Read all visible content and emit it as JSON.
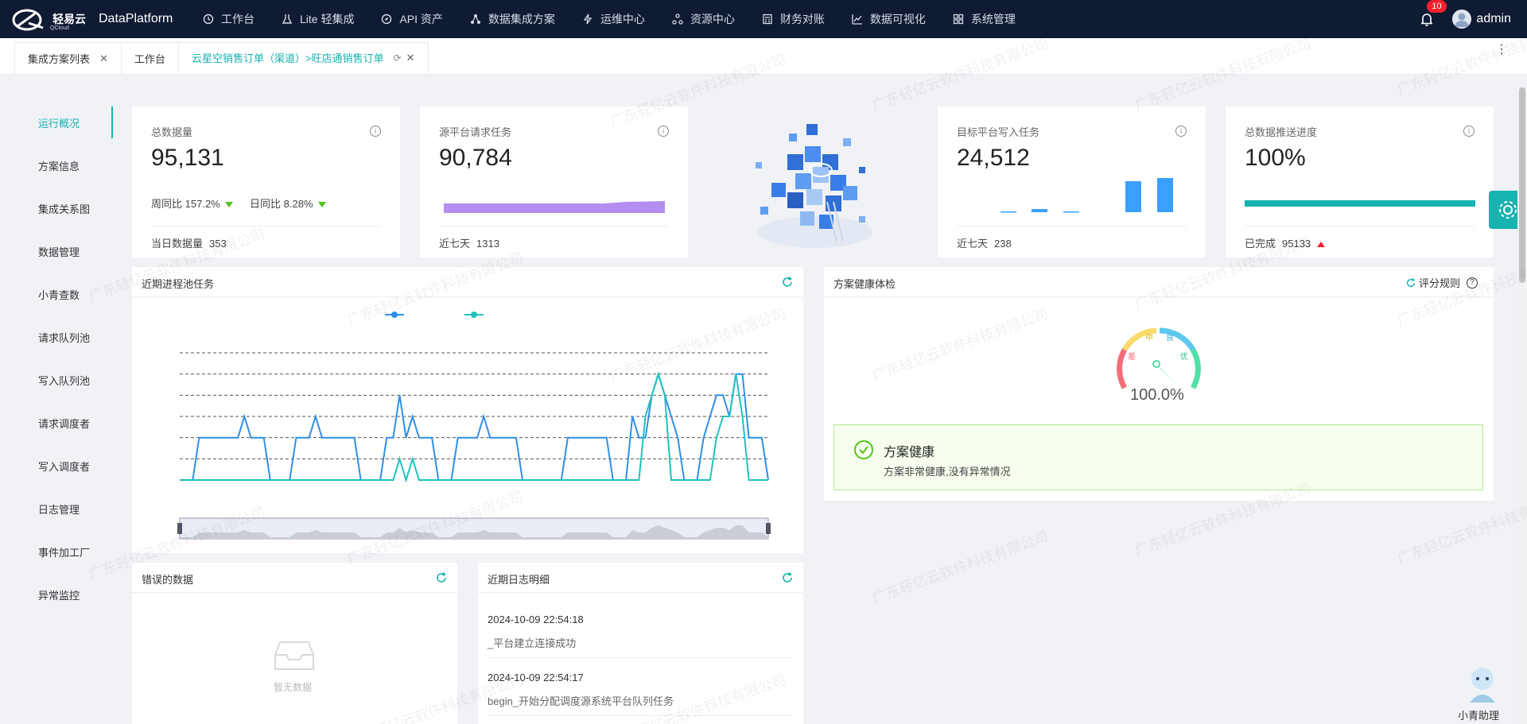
{
  "app": {
    "logo_text": "轻易云",
    "logo_sub": "QCloud",
    "product": "DataPlatform"
  },
  "nav": {
    "items": [
      {
        "label": "工作台",
        "icon": "clock-icon"
      },
      {
        "label": "Lite 轻集成",
        "icon": "flask-icon"
      },
      {
        "label": "API 资产",
        "icon": "compass-icon"
      },
      {
        "label": "数据集成方案",
        "icon": "network-icon"
      },
      {
        "label": "运维中心",
        "icon": "bolt-icon"
      },
      {
        "label": "资源中心",
        "icon": "nodes-icon"
      },
      {
        "label": "财务对账",
        "icon": "calculator-icon"
      },
      {
        "label": "数据可视化",
        "icon": "chart-icon"
      },
      {
        "label": "系统管理",
        "icon": "grid-icon"
      }
    ],
    "notification_count": "10",
    "user": "admin"
  },
  "tabs": [
    {
      "label": "集成方案列表",
      "closable": true
    },
    {
      "label": "工作台",
      "closable": false
    },
    {
      "label": "云星空销售订单（渠道）>旺店通销售订单",
      "closable": true,
      "active": true
    }
  ],
  "sidebar": {
    "items": [
      {
        "label": "运行概况",
        "active": true
      },
      {
        "label": "方案信息"
      },
      {
        "label": "集成关系图"
      },
      {
        "label": "数据管理"
      },
      {
        "label": "小青查数"
      },
      {
        "label": "请求队列池"
      },
      {
        "label": "写入队列池"
      },
      {
        "label": "请求调度者"
      },
      {
        "label": "写入调度者"
      },
      {
        "label": "日志管理"
      },
      {
        "label": "事件加工厂"
      },
      {
        "label": "异常监控"
      }
    ]
  },
  "stats": {
    "total": {
      "title": "总数据量",
      "value": "95,131",
      "wow_label": "周同比",
      "wow": "157.2%",
      "dod_label": "日同比",
      "dod": "8.28%",
      "foot_label": "当日数据量",
      "foot_value": "353"
    },
    "source": {
      "title": "源平台请求任务",
      "value": "90,784",
      "foot_label": "近七天",
      "foot_value": "1313"
    },
    "target": {
      "title": "目标平台写入任务",
      "value": "24,512",
      "foot_label": "近七天",
      "foot_value": "238"
    },
    "progress": {
      "title": "总数据推送进度",
      "value": "100%",
      "progress": 1.0,
      "foot_label": "已完成",
      "foot_value": "95133"
    }
  },
  "panels": {
    "pool": {
      "title": "近期进程池任务"
    },
    "health": {
      "title": "方案健康体检",
      "rule_label": "评分规则",
      "gauge_value": "100.0%",
      "gauge_labels": {
        "bad": "差",
        "mid": "中",
        "good": "良",
        "excellent": "优"
      },
      "status_title": "方案健康",
      "status_desc": "方案非常健康,没有异常情况"
    },
    "errors": {
      "title": "错误的数据",
      "empty": "暂无数据"
    },
    "logs": {
      "title": "近期日志明细",
      "entries": [
        {
          "time": "2024-10-09 22:54:18",
          "message": "_平台建立连接成功"
        },
        {
          "time": "2024-10-09 22:54:17",
          "message": "begin_开始分配调度源系统平台队列任务"
        }
      ]
    }
  },
  "assistant": {
    "label": "小青助理"
  },
  "watermark": "广东轻亿云软件科技有限公司",
  "colors": {
    "accent": "#16b3b0",
    "nav_bg": "#0f1b33",
    "series_a": "#2f8fe6",
    "series_b": "#1fc2bd",
    "purple": "#b38ef0",
    "blue_bar": "#3aa0ff"
  },
  "chart_data": [
    {
      "type": "line",
      "series": [
        {
          "values": [
            0,
            0,
            0,
            2,
            2,
            2,
            2,
            2,
            2,
            2,
            3,
            2,
            2,
            2,
            0,
            0,
            0,
            0,
            2,
            2,
            2,
            3,
            2,
            2,
            2,
            2,
            2,
            2,
            0,
            0,
            0,
            0,
            2,
            2,
            4,
            2,
            3,
            2,
            2,
            2,
            0,
            0,
            0,
            2,
            2,
            2,
            2,
            3,
            2,
            2,
            2,
            2,
            2,
            0,
            0,
            0,
            0,
            0,
            0,
            0,
            2,
            2,
            2,
            2,
            2,
            2,
            2,
            0,
            0,
            0,
            3,
            2,
            2,
            4,
            5,
            4,
            3,
            2,
            0,
            0,
            0,
            2,
            3,
            4,
            4,
            3,
            5,
            5,
            2,
            2,
            2,
            0
          ]
        },
        {
          "values": [
            0,
            0,
            0,
            0,
            0,
            0,
            0,
            0,
            0,
            0,
            0,
            0,
            0,
            0,
            0,
            0,
            0,
            0,
            0,
            0,
            0,
            0,
            0,
            0,
            0,
            0,
            0,
            0,
            0,
            0,
            0,
            0,
            0,
            0,
            1,
            0,
            1,
            0,
            0,
            0,
            0,
            0,
            0,
            0,
            0,
            0,
            0,
            0,
            0,
            0,
            0,
            0,
            0,
            0,
            0,
            0,
            0,
            0,
            0,
            0,
            0,
            0,
            0,
            0,
            0,
            0,
            0,
            0,
            0,
            0,
            0,
            0,
            3,
            4,
            5,
            4,
            0,
            0,
            0,
            0,
            0,
            0,
            0,
            2,
            3,
            3,
            5,
            3,
            0,
            0,
            0,
            0
          ]
        }
      ],
      "ylim": [
        0,
        6
      ],
      "grid": true
    }
  ]
}
